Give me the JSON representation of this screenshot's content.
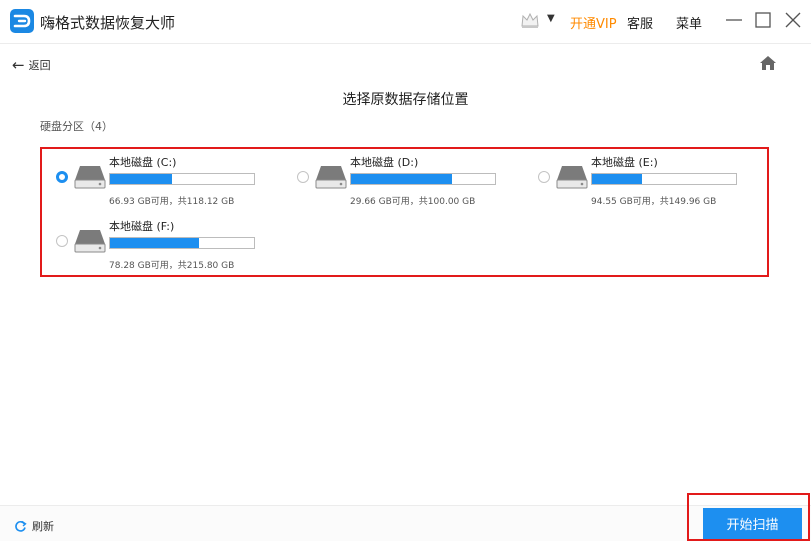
{
  "app": {
    "title": "嗨格式数据恢复大师",
    "logo_icon": "app-logo-icon"
  },
  "titlebar": {
    "vip_label": "开通VIP",
    "service_label": "客服",
    "menu_label": "菜单",
    "vip_color": "#ff8a00"
  },
  "nav": {
    "back_label": "返回"
  },
  "page": {
    "title": "选择原数据存储位置",
    "partition_label": "硬盘分区（4）"
  },
  "disks": [
    {
      "name": "本地磁盘 (C:)",
      "space": "66.93 GB可用，共118.12 GB",
      "used_fraction": 0.43,
      "selected": true
    },
    {
      "name": "本地磁盘 (D:)",
      "space": "29.66 GB可用，共100.00 GB",
      "used_fraction": 0.7,
      "selected": false
    },
    {
      "name": "本地磁盘 (E:)",
      "space": "94.55 GB可用，共149.96 GB",
      "used_fraction": 0.35,
      "selected": false
    },
    {
      "name": "本地磁盘 (F:)",
      "space": "78.28 GB可用，共215.80 GB",
      "used_fraction": 0.62,
      "selected": false
    }
  ],
  "footer": {
    "refresh_label": "刷新",
    "scan_label": "开始扫描"
  },
  "colors": {
    "accent": "#1d8ff0",
    "highlight": "#e21a1a"
  }
}
